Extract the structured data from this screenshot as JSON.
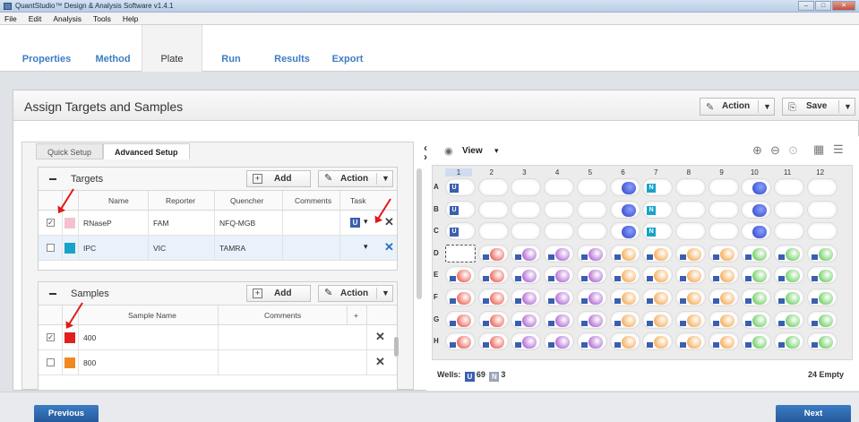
{
  "window": {
    "title": "QuantStudio™ Design & Analysis Software v1.4.1",
    "controls": [
      "–",
      "□",
      "✕"
    ]
  },
  "menu": [
    "File",
    "Edit",
    "Analysis",
    "Tools",
    "Help"
  ],
  "nav": {
    "tabs": [
      "Properties",
      "Method",
      "Plate",
      "Run",
      "Results",
      "Export"
    ],
    "active": "Plate"
  },
  "page": {
    "title": "Assign Targets and Samples",
    "action_label": "Action",
    "save_label": "Save"
  },
  "setup_tabs": [
    "Quick Setup",
    "Advanced Setup"
  ],
  "targets": {
    "title": "Targets",
    "add_label": "Add",
    "action_label": "Action",
    "columns": [
      "Name",
      "Reporter",
      "Quencher",
      "Comments",
      "Task"
    ],
    "rows": [
      {
        "checked": true,
        "color": "#f6c1cf",
        "name": "RNaseP",
        "reporter": "FAM",
        "quencher": "NFQ-MGB",
        "comments": "",
        "task": "U"
      },
      {
        "checked": false,
        "color": "#1aa3c8",
        "name": "IPC",
        "reporter": "VIC",
        "quencher": "TAMRA",
        "comments": "",
        "task": ""
      }
    ]
  },
  "samples": {
    "title": "Samples",
    "add_label": "Add",
    "action_label": "Action",
    "columns": [
      "Sample Name",
      "Comments",
      "+"
    ],
    "rows": [
      {
        "checked": true,
        "color": "#e02020",
        "name": "400"
      },
      {
        "checked": false,
        "color": "#f08a20",
        "name": "800"
      }
    ]
  },
  "plate": {
    "view_label": "View",
    "columns": [
      "1",
      "2",
      "3",
      "4",
      "5",
      "6",
      "7",
      "8",
      "9",
      "10",
      "11",
      "12"
    ],
    "rows": [
      "A",
      "B",
      "C",
      "D",
      "E",
      "F",
      "G",
      "H"
    ],
    "wells_label": "Wells:",
    "unknown_count": "69",
    "ntc_count": "3",
    "empty_label": "24 Empty"
  },
  "footer": {
    "previous": "Previous",
    "next": "Next"
  },
  "colors": {
    "accent": "#3b7dc4",
    "unknown": "#3a5fb0",
    "ntc": "#1aa3c8",
    "red": "#e53a2b",
    "purple": "#9a3fc8",
    "orange": "#f2962a",
    "green": "#48c23c",
    "blue": "#2a3fc0"
  }
}
